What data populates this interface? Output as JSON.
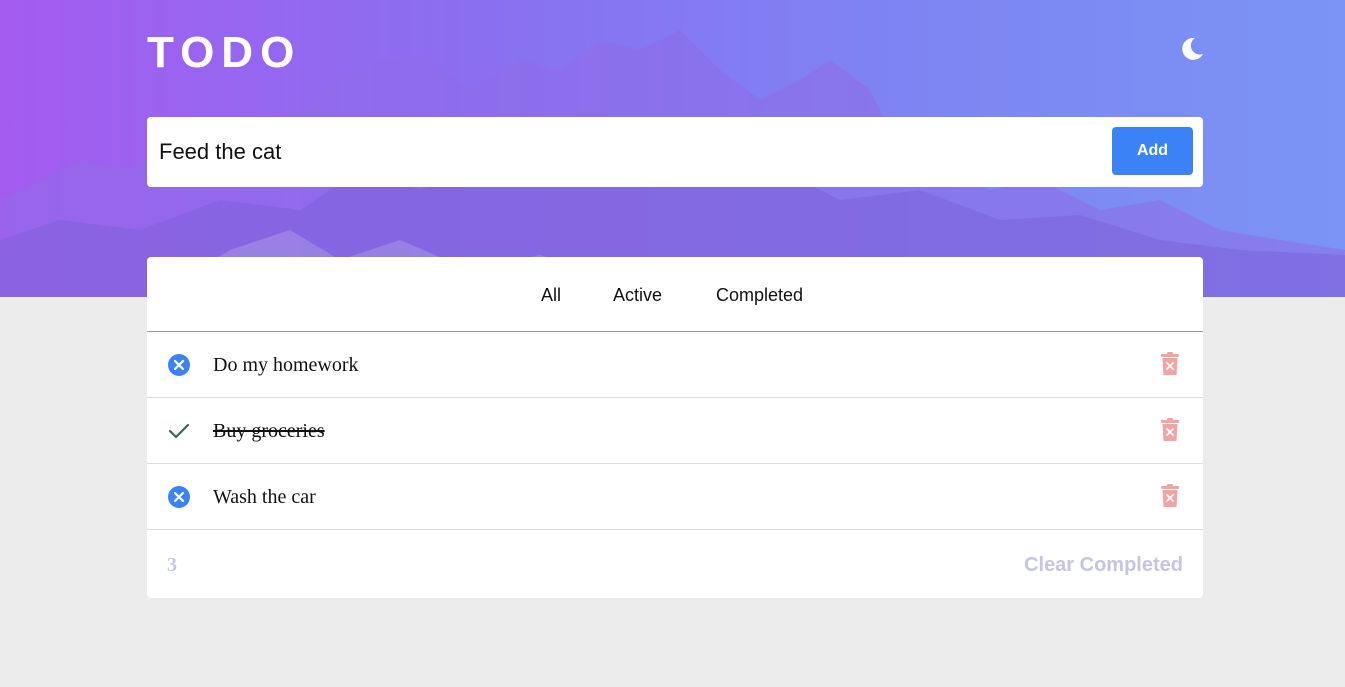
{
  "header": {
    "title": "TODO",
    "theme_icon": "moon-icon"
  },
  "add_form": {
    "input_value": "Feed the cat",
    "button_label": "Add"
  },
  "filters": {
    "tabs": [
      {
        "label": "All"
      },
      {
        "label": "Active"
      },
      {
        "label": "Completed"
      }
    ]
  },
  "todos": [
    {
      "text": "Do my homework",
      "completed": false,
      "status_icon": "x-circle-icon",
      "delete_icon": "trash-icon"
    },
    {
      "text": "Buy groceries",
      "completed": true,
      "status_icon": "check-icon",
      "delete_icon": "trash-icon"
    },
    {
      "text": "Wash the car",
      "completed": false,
      "status_icon": "x-circle-icon",
      "delete_icon": "trash-icon"
    }
  ],
  "footer": {
    "count": "3",
    "clear_label": "Clear Completed"
  },
  "colors": {
    "accent": "#3b82f6",
    "trash": "#f4a3a3",
    "check": "#2f6b55",
    "muted": "#c4c4e6"
  }
}
